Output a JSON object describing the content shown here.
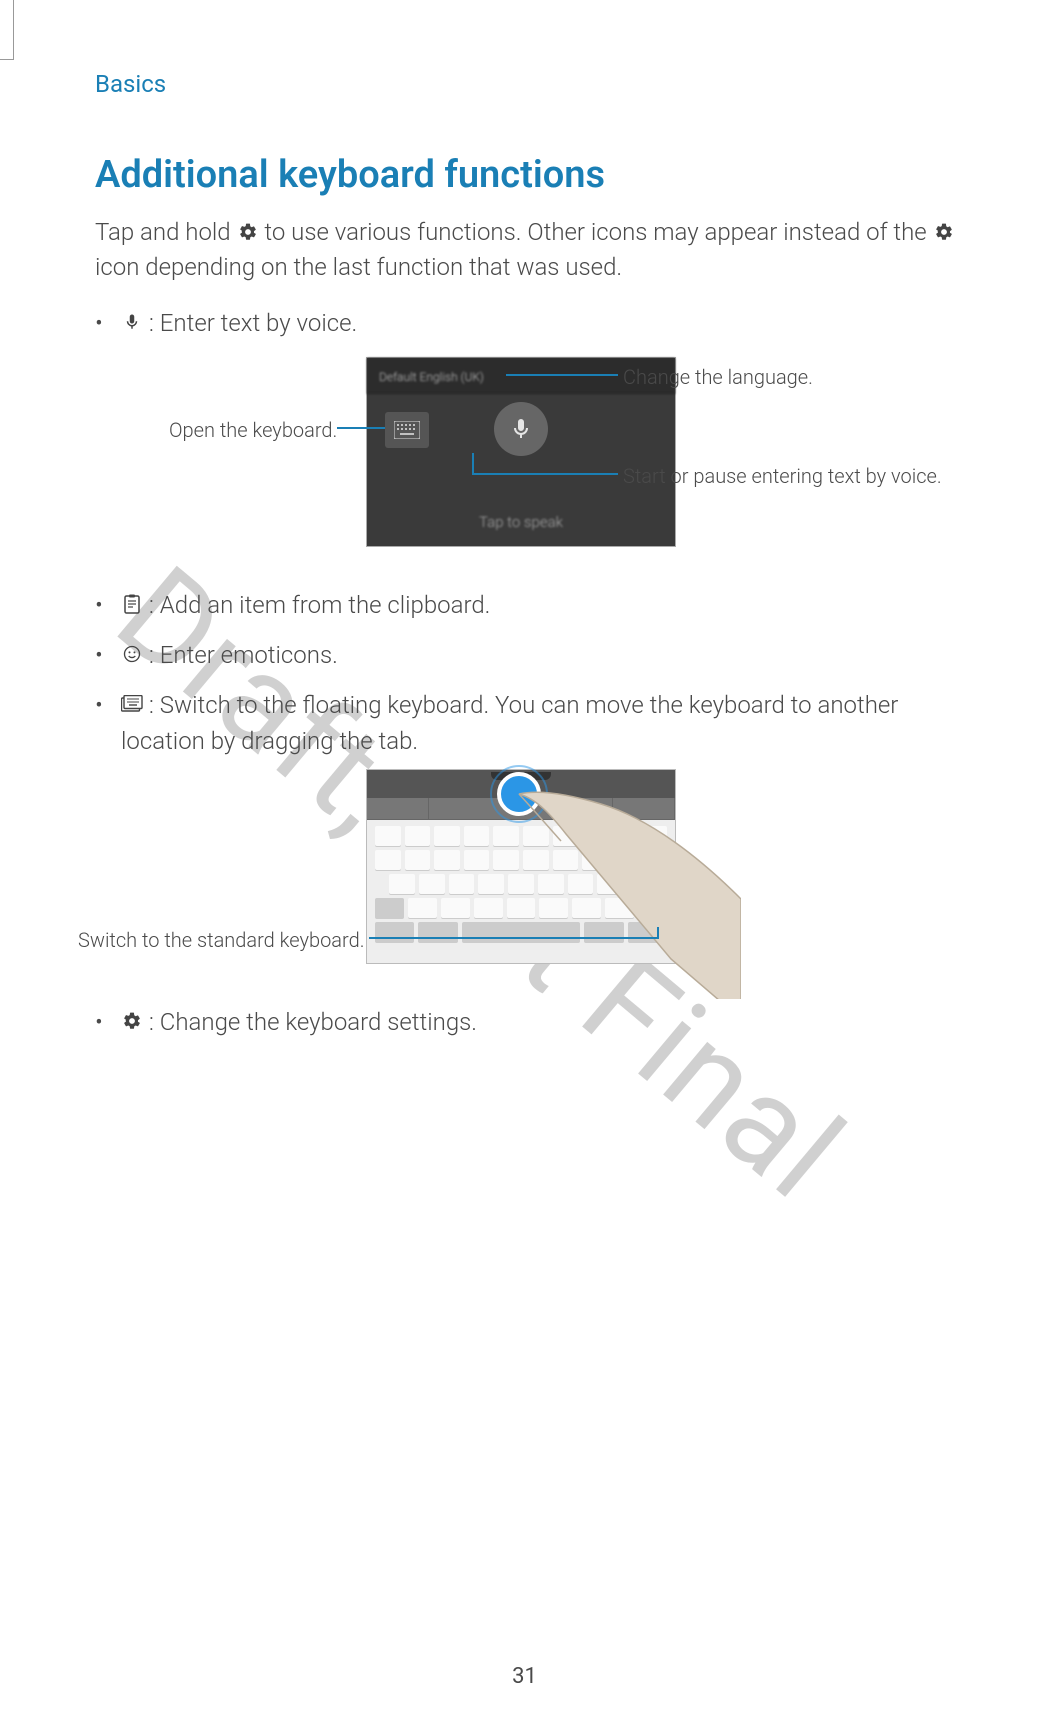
{
  "breadcrumb": "Basics",
  "heading": "Additional keyboard functions",
  "intro_part1": "Tap and hold ",
  "intro_part2": " to use various functions. Other icons may appear instead of the ",
  "intro_part3": " icon depending on the last function that was used.",
  "bullets": {
    "voice": " : Enter text by voice.",
    "clipboard": " : Add an item from the clipboard.",
    "emoticons": " : Enter emoticons.",
    "floating": " : Switch to the floating keyboard. You can move the keyboard to another location by dragging the tab.",
    "settings": " : Change the keyboard settings."
  },
  "fig1": {
    "open_keyboard": "Open the keyboard.",
    "change_language": "Change the language.",
    "start_pause": "Start or pause entering text by voice.",
    "header_text": "Default English (UK)",
    "footer_text": "Tap to speak"
  },
  "fig2": {
    "switch_standard": "Switch to the standard keyboard."
  },
  "watermark": "Draft, Not Final",
  "page_number": "31"
}
